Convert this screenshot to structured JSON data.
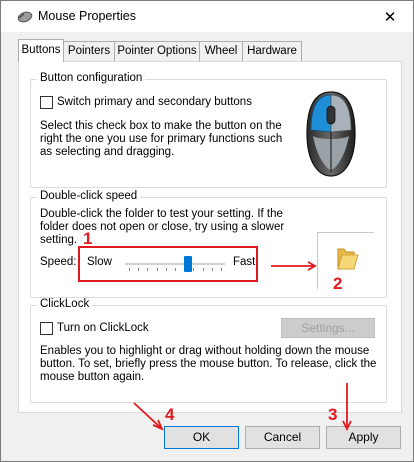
{
  "window": {
    "title": "Mouse Properties",
    "close_symbol": "✕"
  },
  "tabs": [
    {
      "label": "Buttons",
      "active": true
    },
    {
      "label": "Pointers",
      "active": false
    },
    {
      "label": "Pointer Options",
      "active": false
    },
    {
      "label": "Wheel",
      "active": false
    },
    {
      "label": "Hardware",
      "active": false
    }
  ],
  "button_config": {
    "legend": "Button configuration",
    "checkbox_label": "Switch primary and secondary buttons",
    "checked": false,
    "desc_lines": [
      "Select this check box to make the button on the",
      "right the one you use for primary functions such",
      "as selecting and dragging."
    ]
  },
  "double_click": {
    "legend": "Double-click speed",
    "desc_lines": [
      "Double-click the folder to test your setting. If the",
      "folder does not open or close, try using a slower",
      "setting."
    ],
    "speed_label": "Speed:",
    "slow_label": "Slow",
    "fast_label": "Fast",
    "slider_value": 0.64
  },
  "clicklock": {
    "legend": "ClickLock",
    "checkbox_label": "Turn on ClickLock",
    "checked": false,
    "settings_label": "Settings...",
    "desc_lines": [
      "Enables you to highlight or drag without holding down the mouse",
      "button. To set, briefly press the mouse button. To release, click the",
      "mouse button again."
    ]
  },
  "footer": {
    "ok_label": "OK",
    "cancel_label": "Cancel",
    "apply_label": "Apply"
  },
  "annotations": {
    "n1": "1",
    "n2": "2",
    "n3": "3",
    "n4": "4",
    "color": "#e0191e"
  }
}
